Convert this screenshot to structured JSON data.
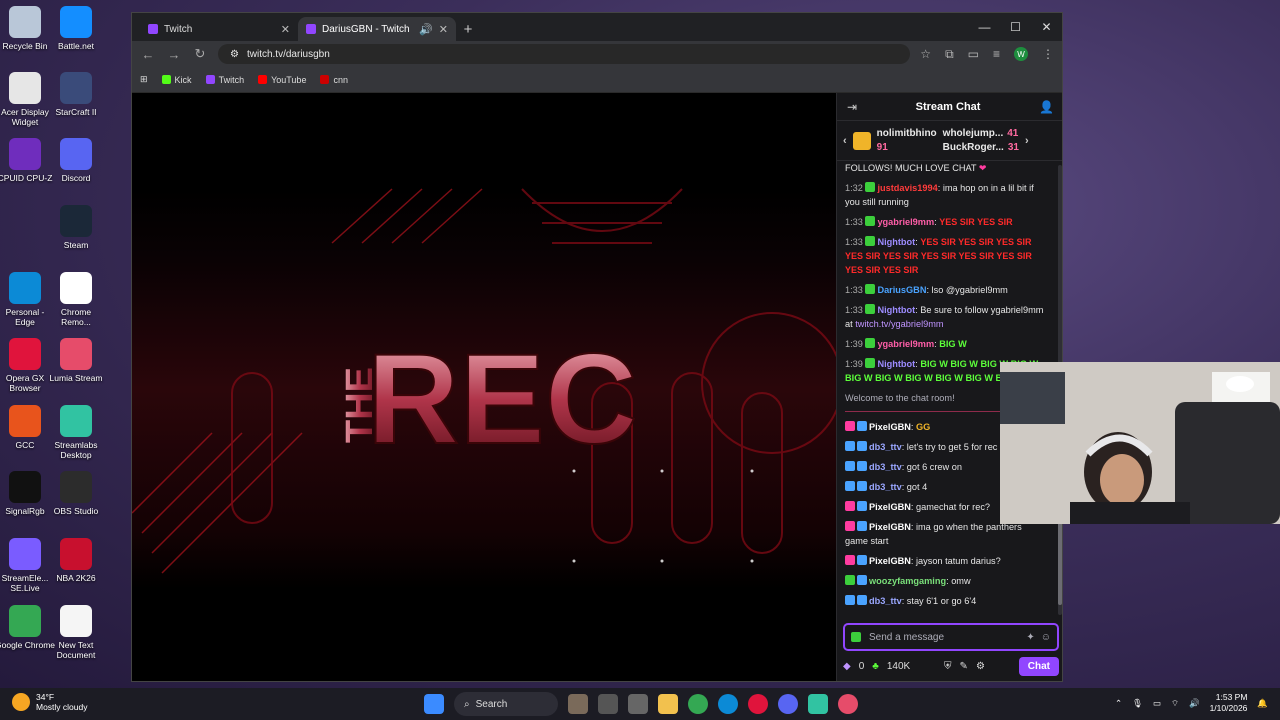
{
  "desktop": {
    "icons": [
      {
        "label": "Recycle Bin",
        "icon": "recycle-bin-icon",
        "color": "#b9c7d8"
      },
      {
        "label": "Battle.net",
        "icon": "battlenet-icon",
        "color": "#148eff"
      },
      {
        "label": "Acer Display Widget",
        "icon": "acer-icon",
        "color": "#e6e6e6"
      },
      {
        "label": "StarCraft II",
        "icon": "starcraft-icon",
        "color": "#3a4b7a"
      },
      {
        "label": "CPUID CPU-Z",
        "icon": "cpuz-icon",
        "color": "#6f2dbd"
      },
      {
        "label": "Discord",
        "icon": "discord-icon",
        "color": "#5865f2"
      },
      {
        "label": "Steam",
        "icon": "steam-icon",
        "color": "#1b2838"
      },
      {
        "label": "Personal - Edge",
        "icon": "edge-icon",
        "color": "#0c8ad6"
      },
      {
        "label": "Chrome Remo...",
        "icon": "chrome-remote-icon",
        "color": "#ffffff"
      },
      {
        "label": "Opera GX Browser",
        "icon": "opera-gx-icon",
        "color": "#e0143c"
      },
      {
        "label": "Lumia Stream",
        "icon": "lumia-icon",
        "color": "#e64c6a"
      },
      {
        "label": "GCC",
        "icon": "gcc-icon",
        "color": "#e8541c"
      },
      {
        "label": "Streamlabs Desktop",
        "icon": "streamlabs-icon",
        "color": "#31c3a2"
      },
      {
        "label": "SignalRgb",
        "icon": "signalrgb-icon",
        "color": "#111111"
      },
      {
        "label": "OBS Studio",
        "icon": "obs-icon",
        "color": "#2c2c2c"
      },
      {
        "label": "StreamEle... SE.Live",
        "icon": "streamelements-icon",
        "color": "#7a5cff"
      },
      {
        "label": "NBA 2K26",
        "icon": "nba2k-icon",
        "color": "#c8102e"
      },
      {
        "label": "Google Chrome",
        "icon": "chrome-icon",
        "color": "#34a853"
      },
      {
        "label": "New Text Document",
        "icon": "text-document-icon",
        "color": "#f5f5f5"
      }
    ]
  },
  "browser": {
    "tabs": [
      {
        "title": "Twitch",
        "active": false
      },
      {
        "title": "DariusGBN - Twitch",
        "active": true
      }
    ],
    "url": "twitch.tv/dariusgbn",
    "bookmarks": [
      {
        "label": "Kick",
        "color": "#53fc18"
      },
      {
        "label": "Twitch",
        "color": "#9146ff"
      },
      {
        "label": "YouTube",
        "color": "#ff0000"
      },
      {
        "label": "cnn",
        "color": "#cc0000"
      }
    ],
    "profile_initial": "W"
  },
  "stream": {
    "overlay_title_small": "THE",
    "overlay_title_big": "REC",
    "accent": "#c81e2a"
  },
  "chat": {
    "title": "Stream Chat",
    "leaderboard": {
      "left": {
        "name": "nolimitbhino",
        "count": "91"
      },
      "right": [
        {
          "name": "wholejump...",
          "count": "41"
        },
        {
          "name": "BuckRoger...",
          "count": "31"
        }
      ]
    },
    "messages": [
      {
        "time": "",
        "user": "",
        "user_color": "#e6e6e6",
        "text": "FOLLOWS! MUCH LOVE CHAT",
        "emote": "❤"
      },
      {
        "time": "1:32",
        "user": "justdavis1994",
        "user_color": "#ff3b3b",
        "text": ": ima hop on in a lil bit if you still running",
        "emote": ""
      },
      {
        "time": "1:33",
        "user": "ygabriel9mm",
        "user_color": "#ff5ea8",
        "text": ":",
        "emote": "YES SIR YES SIR"
      },
      {
        "time": "1:33",
        "user": "Nightbot",
        "user_color": "#9d8cff",
        "text": ":",
        "emote": "YES SIR YES SIR YES SIR YES SIR YES SIR YES SIR YES SIR YES SIR YES SIR YES SIR"
      },
      {
        "time": "1:33",
        "user": "DariusGBN",
        "user_color": "#4aa3ff",
        "text": ": lso @ygabriel9mm",
        "emote": ""
      },
      {
        "time": "1:33",
        "user": "Nightbot",
        "user_color": "#9d8cff",
        "text": ": Be sure to follow ygabriel9mm at",
        "link": "twitch.tv/ygabriel9mm",
        "emote": ""
      },
      {
        "time": "1:39",
        "user": "ygabriel9mm",
        "user_color": "#ff5ea8",
        "text": ":",
        "emote": "BIG W"
      },
      {
        "time": "1:39",
        "user": "Nightbot",
        "user_color": "#9d8cff",
        "text": ":",
        "emote": "BIG W BIG W BIG W BIG W BIG W BIG W BIG W BIG W BIG W BIG W"
      }
    ],
    "welcome": "Welcome to the chat room!",
    "messages_after": [
      {
        "user": "PixelGBN",
        "user_color": "#ffffff",
        "badge": "#ff3ca0",
        "text": ":",
        "emote": "GG"
      },
      {
        "user": "db3_ttv",
        "user_color": "#9aa7ff",
        "badge": "#4aa3ff",
        "text": ": let's try to get 5 for rec"
      },
      {
        "user": "db3_ttv",
        "user_color": "#9aa7ff",
        "badge": "#4aa3ff",
        "text": ": got 6 crew on"
      },
      {
        "user": "db3_ttv",
        "user_color": "#9aa7ff",
        "badge": "#4aa3ff",
        "text": ": got 4"
      },
      {
        "user": "PixelGBN",
        "user_color": "#ffffff",
        "badge": "#ff3ca0",
        "text": ": gamechat for rec?"
      },
      {
        "user": "PixelGBN",
        "user_color": "#ffffff",
        "badge": "#ff3ca0",
        "text": ": ima go when the panthers game start"
      },
      {
        "user": "PixelGBN",
        "user_color": "#ffffff",
        "badge": "#ff3ca0",
        "text": ": jayson tatum darius?"
      },
      {
        "user": "woozyfamgaming",
        "user_color": "#7adf7a",
        "badge": "#3ccf3c",
        "text": ": omw"
      },
      {
        "user": "db3_ttv",
        "user_color": "#9aa7ff",
        "badge": "#4aa3ff",
        "text": ": stay 6'1 or go 6'4"
      }
    ],
    "input_placeholder": "Send a message",
    "bits": "0",
    "points": "140K",
    "chat_button": "Chat"
  },
  "taskbar": {
    "weather_temp": "34°F",
    "weather_desc": "Mostly cloudy",
    "search_label": "Search",
    "time": "1:53 PM",
    "date": "1/10/2026"
  }
}
